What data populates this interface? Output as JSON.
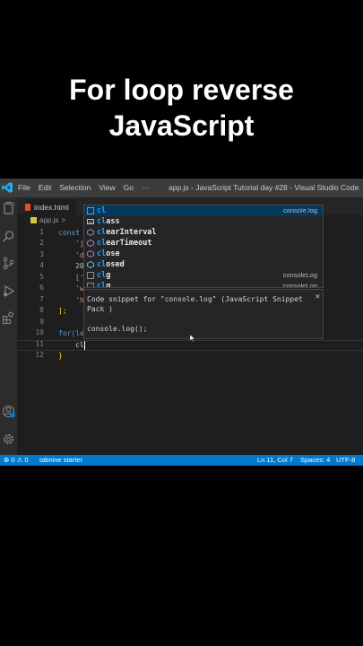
{
  "caption": {
    "line1": "For loop reverse",
    "line2": "JavaScript"
  },
  "titlebar": {
    "menu": [
      "File",
      "Edit",
      "Selection",
      "View",
      "Go",
      "···"
    ],
    "window_title": "app.js - JavaScript Tutorial day #28 - Visual Studio Code"
  },
  "tab": {
    "label": "index.html"
  },
  "breadcrumb": {
    "file": "app.js",
    "sep": ">"
  },
  "line_numbers": [
    "1",
    "2",
    "3",
    "4",
    "5",
    "6",
    "7",
    "8",
    "9",
    "10",
    "11",
    "12"
  ],
  "code": {
    "line1": "const",
    "line2": "'j",
    "line3": "'d",
    "line4": "20",
    "line5": "['",
    "line6": "'w",
    "line7": "'h",
    "line8": "];",
    "line10_kw": "for(",
    "line10_rest": "le",
    "line11": "cl",
    "line12": "}"
  },
  "suggestions": [
    {
      "label_hl": "cl",
      "label_rest": "",
      "detail": "console.log",
      "icon": "snippet-icon",
      "selected": true
    },
    {
      "label_hl": "cl",
      "label_rest": "ass",
      "detail": "",
      "icon": "keyword-icon",
      "selected": false
    },
    {
      "label_hl": "cl",
      "label_rest": "earInterval",
      "detail": "",
      "icon": "method-icon",
      "selected": false
    },
    {
      "label_hl": "cl",
      "label_rest": "earTimeout",
      "detail": "",
      "icon": "method-icon",
      "selected": false
    },
    {
      "label_hl": "cl",
      "label_rest": "ose",
      "detail": "",
      "icon": "method-icon",
      "selected": false
    },
    {
      "label_hl": "cl",
      "label_rest": "osed",
      "detail": "",
      "icon": "variable-icon",
      "selected": false
    },
    {
      "label_hl": "cl",
      "label_rest": "g",
      "detail": "consoleLog",
      "icon": "snippet-icon",
      "selected": false
    },
    {
      "label_hl": "cl",
      "label_rest": "g",
      "detail": "consoleLog",
      "icon": "snippet-icon",
      "selected": false
    }
  ],
  "docs": {
    "description": "Code snippet for \"console.log\" (JavaScript Snippet Pack )",
    "close": "×",
    "body": "console.log();"
  },
  "status": {
    "problems": "⊗ 0 ⚠ 0",
    "tabnine": "tabnine starter",
    "position": "Ln 11, Col 7",
    "spaces": "Spaces: 4",
    "encoding": "UTF-8"
  },
  "colors": {
    "accent": "#007acc",
    "editor_bg": "#1e1e1e",
    "keyword": "#569cd6",
    "string": "#ce9178",
    "match_highlight": "#18a3ff"
  }
}
